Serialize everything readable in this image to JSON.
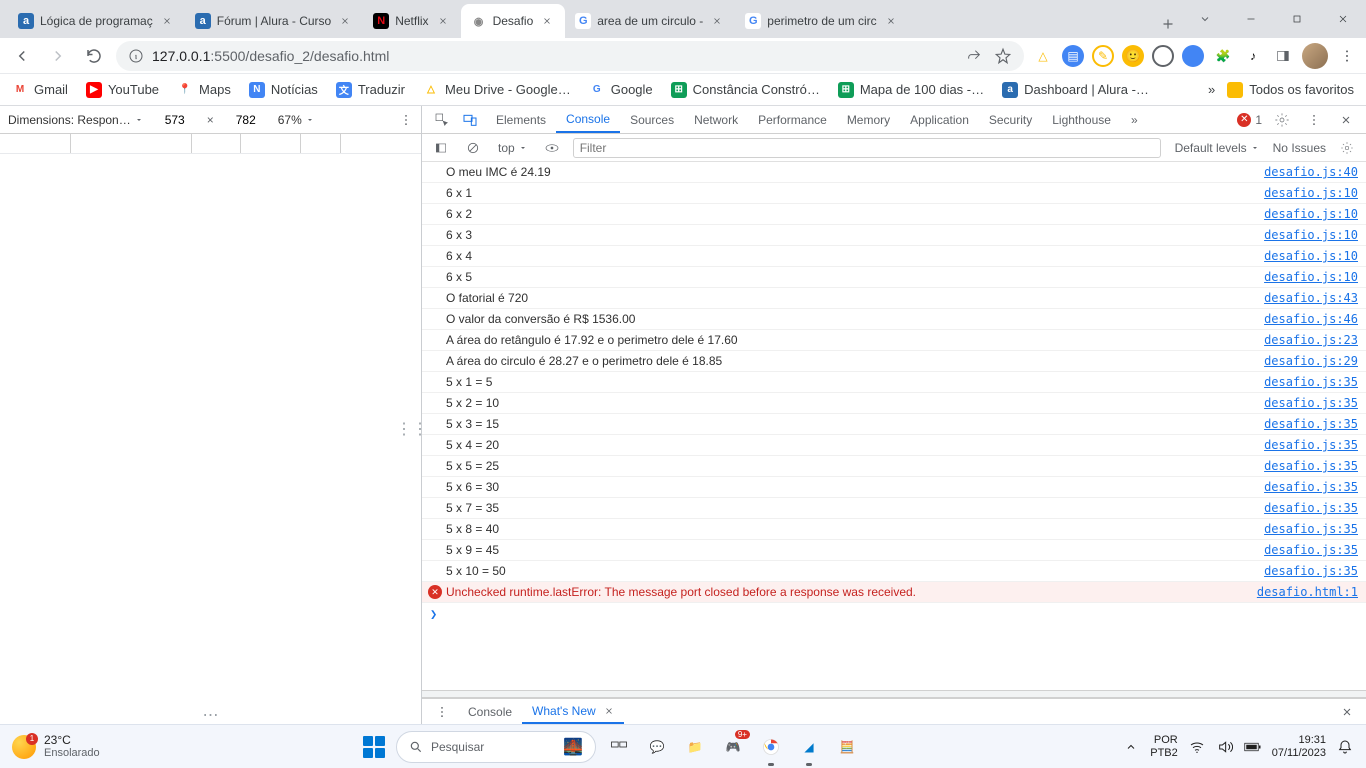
{
  "titlebar": {
    "tabs": [
      {
        "title": "Lógica de programaç",
        "fav_bg": "#2b6cb0",
        "fav_text": "a",
        "fav_color": "#fff"
      },
      {
        "title": "Fórum | Alura - Curso",
        "fav_bg": "#2b6cb0",
        "fav_text": "a",
        "fav_color": "#fff"
      },
      {
        "title": "Netflix",
        "fav_bg": "#000",
        "fav_text": "N",
        "fav_color": "#e50914"
      },
      {
        "title": "Desafio",
        "fav_bg": "#fff",
        "fav_text": "◉",
        "fav_color": "#888",
        "active": true
      },
      {
        "title": "area de um circulo -",
        "fav_bg": "#fff",
        "fav_text": "G",
        "fav_color": "#4285f4"
      },
      {
        "title": "perimetro de um circ",
        "fav_bg": "#fff",
        "fav_text": "G",
        "fav_color": "#4285f4"
      }
    ]
  },
  "toolbar": {
    "url_host": "127.0.0.1",
    "url_rest": ":5500/desafio_2/desafio.html"
  },
  "bookmarks": {
    "items": [
      {
        "label": "Gmail",
        "bg": "#fff",
        "glyph": "M",
        "glyph_color": "#ea4335"
      },
      {
        "label": "YouTube",
        "bg": "#ff0000",
        "glyph": "▶",
        "glyph_color": "#fff"
      },
      {
        "label": "Maps",
        "bg": "#fff",
        "glyph": "📍",
        "glyph_color": ""
      },
      {
        "label": "Notícias",
        "bg": "#4285f4",
        "glyph": "N",
        "glyph_color": "#fff"
      },
      {
        "label": "Traduzir",
        "bg": "#4285f4",
        "glyph": "文",
        "glyph_color": "#fff"
      },
      {
        "label": "Meu Drive - Google…",
        "bg": "#fff",
        "glyph": "△",
        "glyph_color": "#fbbc04"
      },
      {
        "label": "Google",
        "bg": "#fff",
        "glyph": "G",
        "glyph_color": "#4285f4"
      },
      {
        "label": "Constância Constró…",
        "bg": "#0f9d58",
        "glyph": "⊞",
        "glyph_color": "#fff"
      },
      {
        "label": "Mapa de 100 dias -…",
        "bg": "#0f9d58",
        "glyph": "⊞",
        "glyph_color": "#fff"
      },
      {
        "label": "Dashboard | Alura -…",
        "bg": "#2b6cb0",
        "glyph": "a",
        "glyph_color": "#fff"
      }
    ],
    "overflow_label": "»",
    "right_label": "Todos os favoritos"
  },
  "device": {
    "dim_label": "Dimensions: Respon…",
    "width": "573",
    "height": "782",
    "zoom": "67%"
  },
  "devtools": {
    "tabs": [
      "Elements",
      "Console",
      "Sources",
      "Network",
      "Performance",
      "Memory",
      "Application",
      "Security",
      "Lighthouse"
    ],
    "active_tab": 1,
    "error_count": "1",
    "console_toolbar": {
      "context": "top",
      "filter_placeholder": "Filter",
      "levels": "Default levels",
      "issues": "No Issues"
    },
    "messages": [
      {
        "text": "O meu IMC é 24.19",
        "src": "desafio.js:40"
      },
      {
        "text": "6 x 1",
        "src": "desafio.js:10"
      },
      {
        "text": "6 x 2",
        "src": "desafio.js:10"
      },
      {
        "text": "6 x 3",
        "src": "desafio.js:10"
      },
      {
        "text": "6 x 4",
        "src": "desafio.js:10"
      },
      {
        "text": "6 x 5",
        "src": "desafio.js:10"
      },
      {
        "text": "O fatorial é 720",
        "src": "desafio.js:43"
      },
      {
        "text": "O valor da conversão é R$ 1536.00",
        "src": "desafio.js:46"
      },
      {
        "text": "A área do retângulo é 17.92 e o perimetro dele é 17.60",
        "src": "desafio.js:23"
      },
      {
        "text": "A área do circulo é 28.27 e o perimetro dele é 18.85",
        "src": "desafio.js:29"
      },
      {
        "text": "5 x 1 = 5",
        "src": "desafio.js:35"
      },
      {
        "text": "5 x 2 = 10",
        "src": "desafio.js:35"
      },
      {
        "text": "5 x 3 = 15",
        "src": "desafio.js:35"
      },
      {
        "text": "5 x 4 = 20",
        "src": "desafio.js:35"
      },
      {
        "text": "5 x 5 = 25",
        "src": "desafio.js:35"
      },
      {
        "text": "5 x 6 = 30",
        "src": "desafio.js:35"
      },
      {
        "text": "5 x 7 = 35",
        "src": "desafio.js:35"
      },
      {
        "text": "5 x 8 = 40",
        "src": "desafio.js:35"
      },
      {
        "text": "5 x 9 = 45",
        "src": "desafio.js:35"
      },
      {
        "text": "5 x 10 = 50",
        "src": "desafio.js:35"
      },
      {
        "text": "Unchecked runtime.lastError: The message port closed before a response was received.",
        "src": "desafio.html:1",
        "error": true
      }
    ],
    "drawer": {
      "tabs": [
        "Console",
        "What's New"
      ],
      "active_tab": 1
    }
  },
  "taskbar": {
    "weather": {
      "badge": "1",
      "temp": "23°C",
      "desc": "Ensolarado"
    },
    "search_placeholder": "Pesquisar",
    "lang": {
      "l1": "POR",
      "l2": "PTB2"
    },
    "clock": {
      "time": "19:31",
      "date": "07/11/2023"
    }
  }
}
